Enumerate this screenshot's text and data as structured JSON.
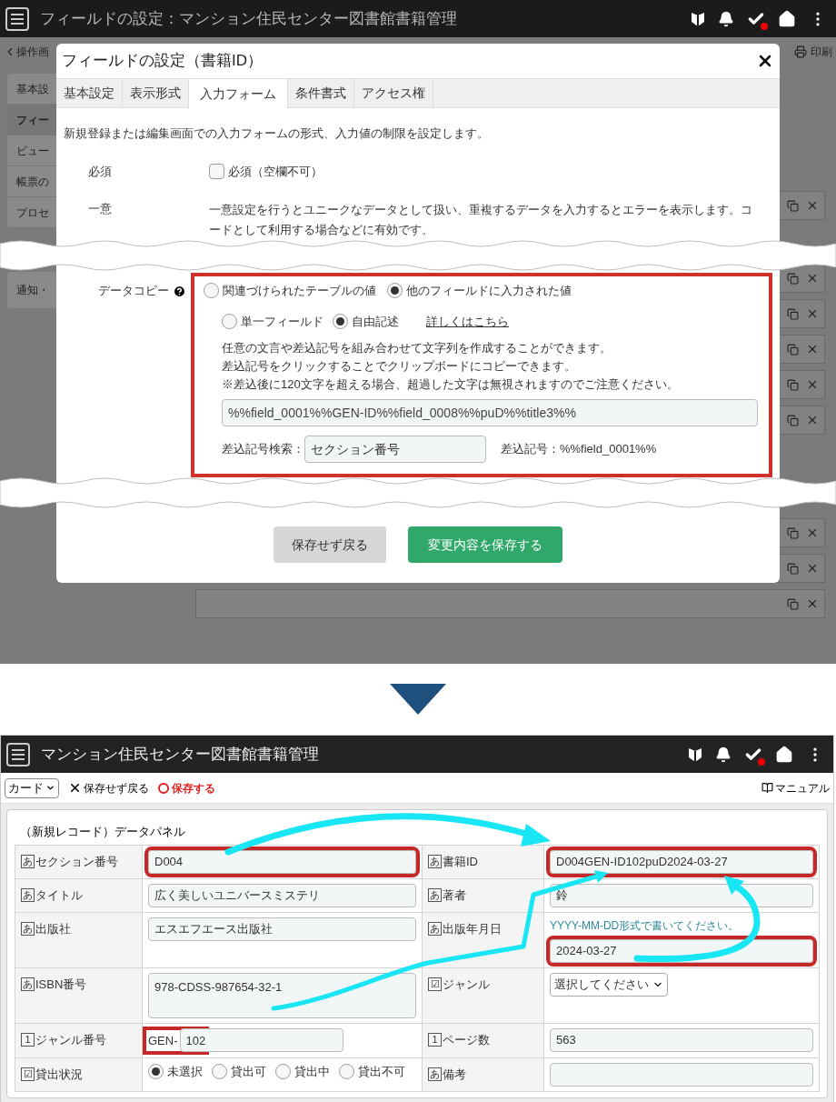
{
  "top": {
    "app_bar": {
      "title": "フィールドの設定：マンション住民センター図書館書籍管理"
    },
    "background": {
      "back_link": "操作画",
      "print": "印刷",
      "side_items": [
        {
          "label": "基本設",
          "selected": false
        },
        {
          "label": "フィー",
          "selected": true
        },
        {
          "label": "ビュー",
          "selected": false
        },
        {
          "label": "帳票の",
          "selected": false
        },
        {
          "label": "プロセ",
          "selected": false
        },
        {
          "label": "通知・",
          "selected": false
        }
      ]
    },
    "dialog": {
      "title": "フィールドの設定（書籍ID）",
      "tabs": [
        {
          "label": "基本設定",
          "selected": false
        },
        {
          "label": "表示形式",
          "selected": false
        },
        {
          "label": "入力フォーム",
          "selected": true
        },
        {
          "label": "条件書式",
          "selected": false
        },
        {
          "label": "アクセス権",
          "selected": false
        }
      ],
      "description": "新規登録または編集画面での入力フォームの形式、入力値の制限を設定します。",
      "required": {
        "label": "必須",
        "option": "必須（空欄不可）",
        "checked": false
      },
      "unique": {
        "label": "一意",
        "text": "一意設定を行うとユニークなデータとして扱い、重複するデータを入力するとエラーを表示します。コードとして利用する場合などに有効です。"
      },
      "data_copy": {
        "label": "データコピー",
        "highlighted": true,
        "source_options": [
          {
            "label": "関連づけられたテーブルの値",
            "selected": false
          },
          {
            "label": "他のフィールドに入力された値",
            "selected": true
          }
        ],
        "mode_options": [
          {
            "label": "単一フィールド",
            "selected": false
          },
          {
            "label": "自由記述",
            "selected": true
          }
        ],
        "help_link": "詳しくはこちら",
        "notes": [
          "任意の文言や差込記号を組み合わせて文字列を作成することができます。",
          "差込記号をクリックすることでクリップボードにコピーできます。",
          "※差込後に120文字を超える場合、超過した文字は無視されますのでご注意ください。"
        ],
        "template": "%%field_0001%%GEN-ID%%field_0008%%puD%%title3%%",
        "search_label": "差込記号検索：",
        "search_value": "セクション番号",
        "symbol": "差込記号：%%field_0001%%"
      },
      "buttons": [
        {
          "label": "保存せず戻る",
          "kind": "secondary"
        },
        {
          "label": "変更内容を保存する",
          "kind": "primary"
        }
      ]
    }
  },
  "bottom": {
    "app_bar": {
      "title": "マンション住民センター図書館書籍管理"
    },
    "toolbar": {
      "view": "カード",
      "cancel": "保存せず戻る",
      "save": "保存する",
      "manual": "マニュアル"
    },
    "panel_title": "（新規レコード）データパネル",
    "rows": [
      [
        {
          "mark": "あ",
          "label": "セクション番号",
          "kind": "input",
          "value": "D004",
          "highlighted": true
        },
        {
          "mark": "あ",
          "label": "書籍ID",
          "kind": "input",
          "value": "D004GEN-ID102puD2024-03-27",
          "highlighted": true
        }
      ],
      [
        {
          "mark": "あ",
          "label": "タイトル",
          "kind": "input",
          "value": "広く美しいユニバースミステリ",
          "highlighted": false
        },
        {
          "mark": "あ",
          "label": "著者",
          "kind": "input",
          "value": "鈴",
          "highlighted": false
        }
      ],
      [
        {
          "mark": "あ",
          "label": "出版社",
          "kind": "input",
          "value": "エスエフエース出版社",
          "highlighted": false
        },
        {
          "mark": "あ",
          "label": "出版年月日",
          "kind": "input",
          "hint": "YYYY-MM-DD形式で書いてください。",
          "value": "2024-03-27",
          "highlighted": true
        }
      ],
      [
        {
          "mark": "あ",
          "label": "ISBN番号",
          "kind": "textarea",
          "value": "978-CDSS-987654-32-1",
          "highlighted": false
        },
        {
          "mark": "☑",
          "label": "ジャンル",
          "kind": "select",
          "value": "選択してください",
          "highlighted": false
        }
      ],
      [
        {
          "mark": "1",
          "label": "ジャンル番号",
          "kind": "prefixed",
          "prefix": "GEN-",
          "value": "102",
          "highlighted": true
        },
        {
          "mark": "1",
          "label": "ページ数",
          "kind": "input",
          "value": "563",
          "highlighted": false
        }
      ],
      [
        {
          "mark": "☑",
          "label": "貸出状況",
          "kind": "radio",
          "options": [
            {
              "label": "未選択",
              "selected": true
            },
            {
              "label": "貸出可",
              "selected": false
            },
            {
              "label": "貸出中",
              "selected": false
            },
            {
              "label": "貸出不可",
              "selected": false
            }
          ]
        },
        {
          "mark": "あ",
          "label": "備考",
          "kind": "input",
          "highlighted": false
        }
      ]
    ]
  }
}
